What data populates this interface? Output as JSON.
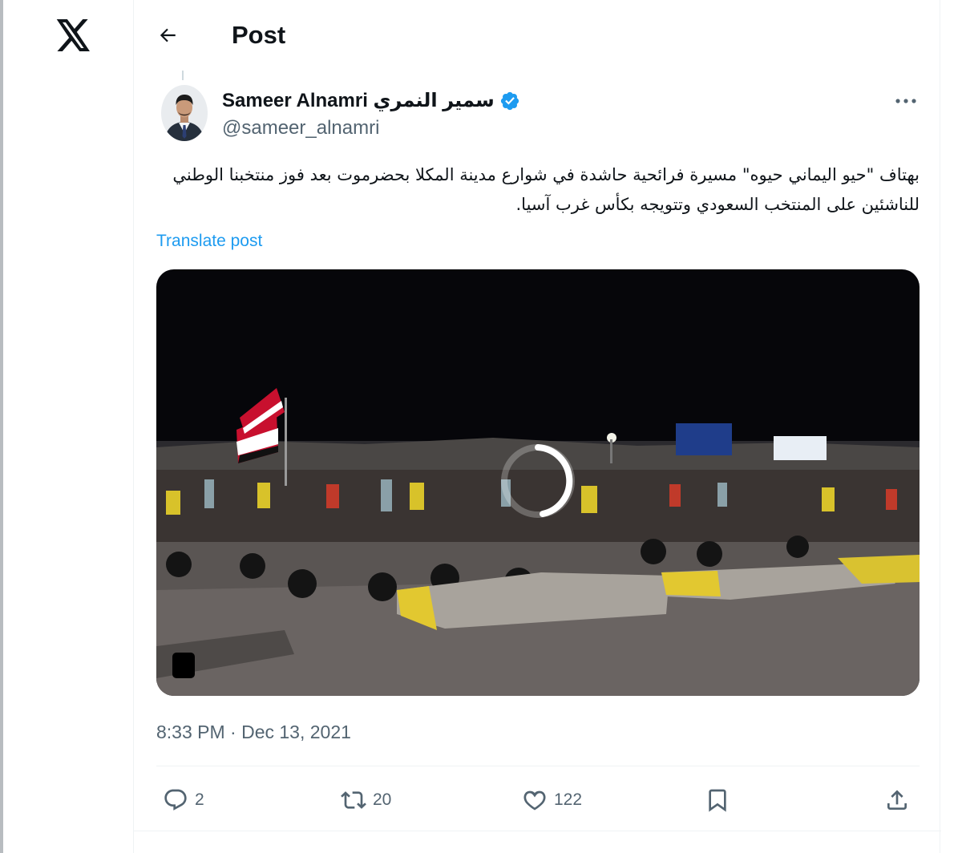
{
  "header": {
    "title": "Post"
  },
  "author": {
    "name": "Sameer Alnamri سمير النمري",
    "handle": "@sameer_alnamri",
    "verified": true
  },
  "post": {
    "text": "بهتاف \"حيو اليماني حيوه\" مسيرة فرائحية حاشدة في شوارع مدينة المكلا بحضرموت بعد فوز منتخبنا الوطني للناشئين على المنتخب السعودي وتتويجه بكأس غرب آسيا.",
    "translate_label": "Translate post",
    "timestamp": "8:33 PM · Dec 13, 2021"
  },
  "actions": {
    "replies": "2",
    "reposts": "20",
    "likes": "122"
  },
  "colors": {
    "accent": "#1d9bf0",
    "text": "#0f1419",
    "secondary": "#536471",
    "border": "#eff3f4"
  },
  "icons": [
    "x-logo-icon",
    "back-arrow-icon",
    "verified-badge-icon",
    "more-icon",
    "reply-icon",
    "repost-icon",
    "like-icon",
    "bookmark-icon",
    "share-icon",
    "loading-spinner-icon"
  ]
}
